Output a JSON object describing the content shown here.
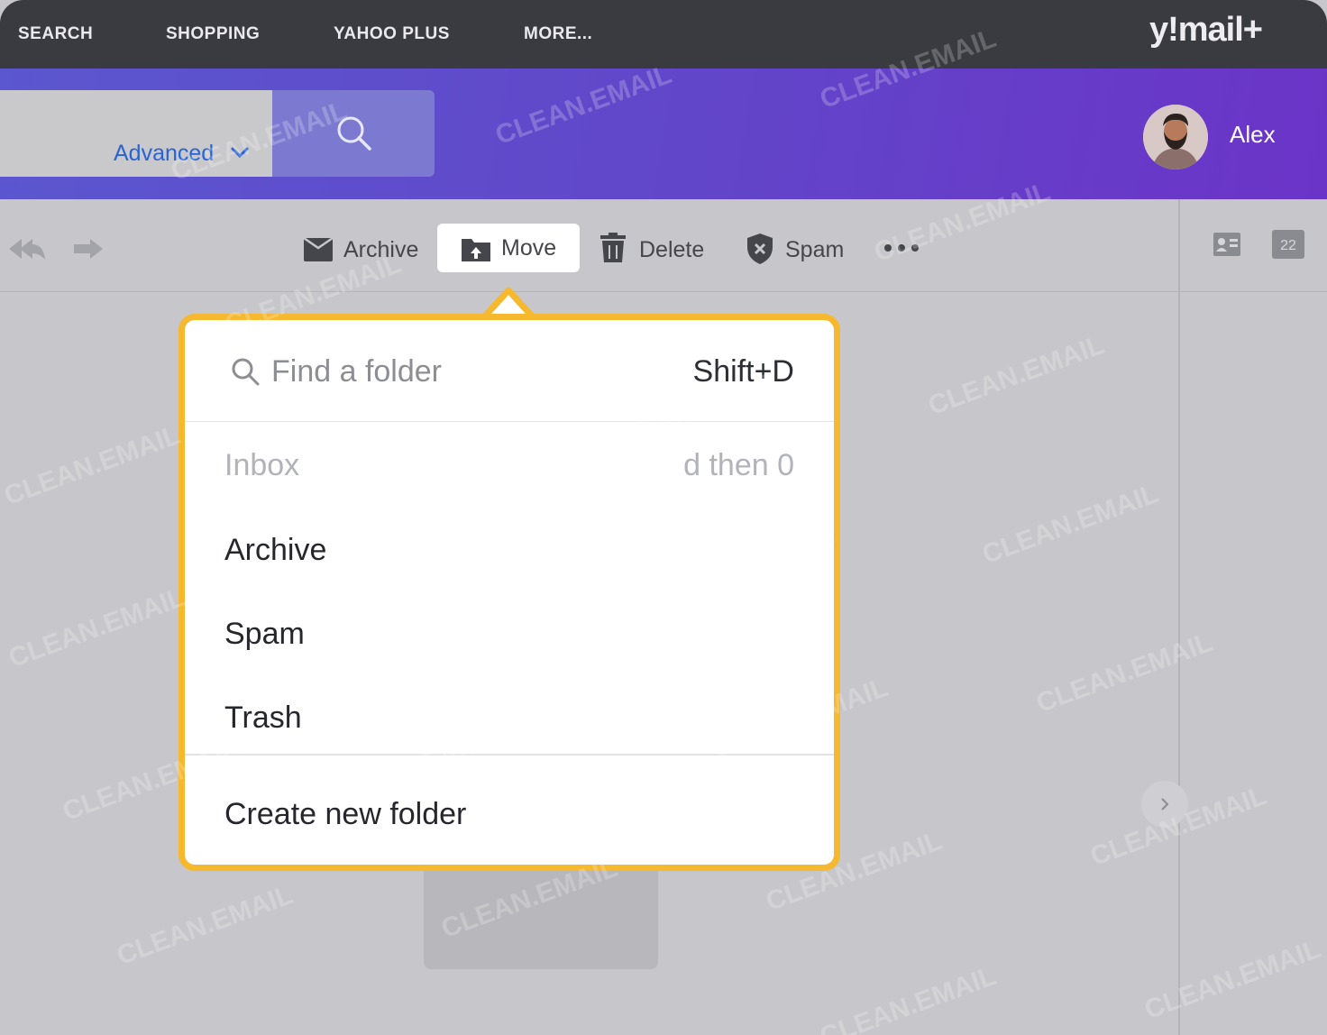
{
  "topnav": {
    "items": [
      "SEARCH",
      "SHOPPING",
      "YAHOO PLUS",
      "MORE..."
    ],
    "logo": "y!mail+"
  },
  "header": {
    "advanced_label": "Advanced",
    "user_name": "Alex"
  },
  "toolbar": {
    "archive": "Archive",
    "move": "Move",
    "delete": "Delete",
    "spam": "Spam",
    "calendar_day": "22"
  },
  "move_menu": {
    "search_placeholder": "Find a folder",
    "search_shortcut": "Shift+D",
    "folders": [
      {
        "label": "Inbox",
        "shortcut": "d then 0",
        "disabled": true
      },
      {
        "label": "Archive"
      },
      {
        "label": "Spam"
      },
      {
        "label": "Trash"
      }
    ],
    "create_label": "Create new folder"
  },
  "watermark": "CLEAN.EMAIL",
  "colors": {
    "accent_gradient_start": "#5b57cf",
    "accent_gradient_end": "#6b34c8",
    "dropdown_border": "#f5b82e",
    "link_blue": "#2a63d3"
  }
}
